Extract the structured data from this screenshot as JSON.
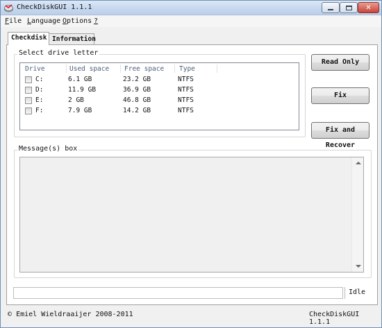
{
  "window": {
    "title": "CheckDiskGUI 1.1.1"
  },
  "menu": [
    {
      "accel": "F",
      "rest": "ile"
    },
    {
      "accel": "L",
      "rest": "anguage"
    },
    {
      "accel": "O",
      "rest": "ptions"
    },
    {
      "accel": "?",
      "rest": ""
    }
  ],
  "tabs": {
    "checkdisk": "Checkdisk",
    "information": "Information"
  },
  "drive_group": {
    "label": "Select drive letter",
    "columns": [
      "Drive",
      "Used space",
      "Free space",
      "Type"
    ],
    "rows": [
      {
        "drive": "C:",
        "used": "6.1 GB",
        "free": "23.2 GB",
        "type": "NTFS",
        "checked": false
      },
      {
        "drive": "D:",
        "used": "11.9 GB",
        "free": "36.9 GB",
        "type": "NTFS",
        "checked": false
      },
      {
        "drive": "E:",
        "used": "2 GB",
        "free": "46.8 GB",
        "type": "NTFS",
        "checked": false
      },
      {
        "drive": "F:",
        "used": "7.9 GB",
        "free": "14.2 GB",
        "type": "NTFS",
        "checked": false
      }
    ]
  },
  "buttons": {
    "read_only": "Read Only",
    "fix": "Fix",
    "fix_recover": "Fix and Recover"
  },
  "message_group": {
    "label": "Message(s) box",
    "content": ""
  },
  "status": {
    "state": "Idle",
    "progress": 0
  },
  "footer": {
    "left": "Emiel Wieldraaijer 2008-2011",
    "right": "CheckDiskGUI 1.1.1",
    "copyright_glyph": "©"
  },
  "colors": {
    "title_gradient": "#c5d7ee",
    "close_button": "#c8443a",
    "list_header": "#4c607a"
  }
}
